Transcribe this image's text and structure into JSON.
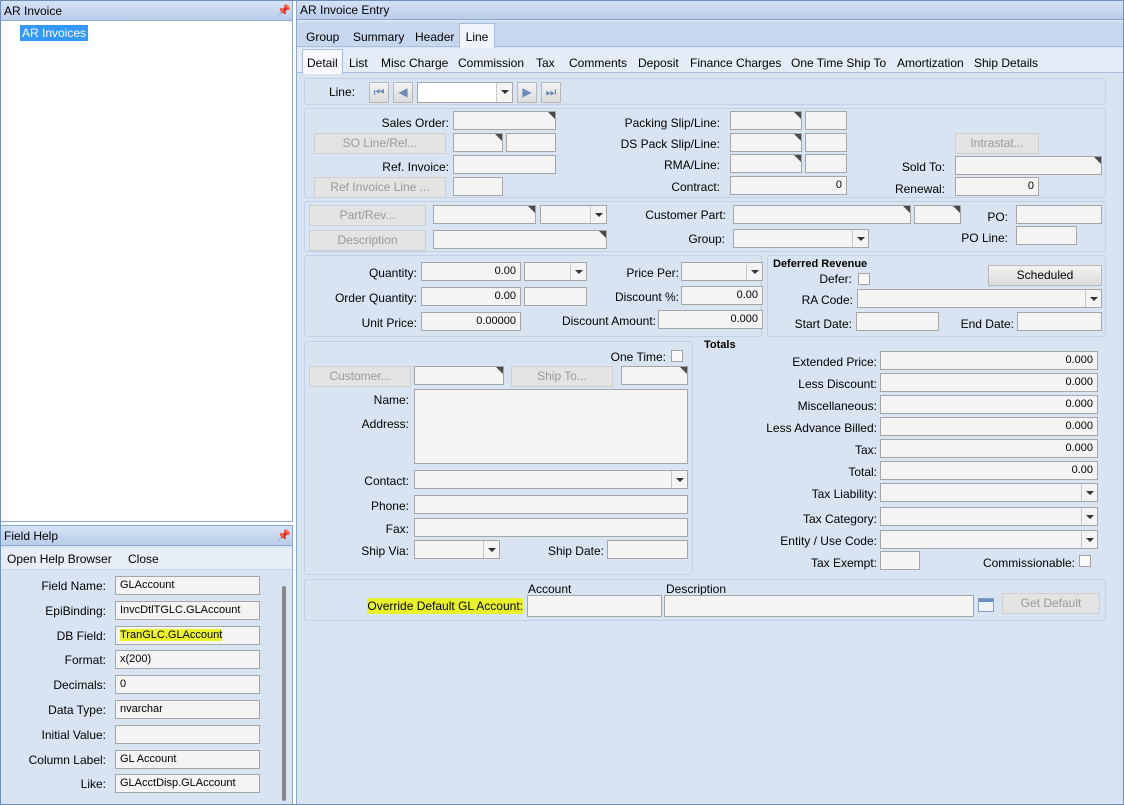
{
  "left_panel": {
    "title": "AR Invoice",
    "tree_item": "AR Invoices"
  },
  "field_help": {
    "title": "Field Help",
    "open_help_browser": "Open Help Browser",
    "close": "Close",
    "rows": [
      {
        "label": "Field Name:",
        "value": "GLAccount"
      },
      {
        "label": "EpiBinding:",
        "value": "InvcDtlTGLC.GLAccount"
      },
      {
        "label": "DB Field:",
        "value": "TranGLC.GLAccount"
      },
      {
        "label": "Format:",
        "value": "x(200)"
      },
      {
        "label": "Decimals:",
        "value": "0"
      },
      {
        "label": "Data Type:",
        "value": "nvarchar"
      },
      {
        "label": "Initial Value:",
        "value": ""
      },
      {
        "label": "Column Label:",
        "value": "GL Account"
      },
      {
        "label": "Like:",
        "value": "GLAcctDisp.GLAccount"
      }
    ]
  },
  "main": {
    "title": "AR Invoice Entry",
    "top_tabs": [
      "Group",
      "Summary",
      "Header",
      "Line"
    ],
    "active_top_tab": "Line",
    "sub_tabs": [
      "Detail",
      "List",
      "Misc Charge",
      "Commission",
      "Tax",
      "Comments",
      "Deposit",
      "Finance Charges",
      "One Time Ship To",
      "Amortization",
      "Ship Details"
    ],
    "active_sub_tab": "Detail",
    "line_label": "Line:",
    "order_section": {
      "sales_order": "Sales Order:",
      "so_line_rel": "SO Line/Rel...",
      "ref_invoice": "Ref. Invoice:",
      "ref_invoice_line": "Ref Invoice Line ...",
      "packing_slip_line": "Packing Slip/Line:",
      "ds_pack_slip_line": "DS Pack Slip/Line:",
      "rma_line": "RMA/Line:",
      "contract": "Contract:",
      "contract_value": "0",
      "intrastat": "Intrastat...",
      "sold_to": "Sold To:",
      "renewal": "Renewal:",
      "renewal_value": "0"
    },
    "part_section": {
      "part_rev": "Part/Rev...",
      "description": "Description",
      "customer_part": "Customer Part:",
      "group": "Group:",
      "po": "PO:",
      "po_line": "PO Line:"
    },
    "qty_section": {
      "quantity": "Quantity:",
      "quantity_value": "0.00",
      "order_quantity": "Order Quantity:",
      "order_quantity_value": "0.00",
      "unit_price": "Unit Price:",
      "unit_price_value": "0.00000",
      "price_per": "Price Per:",
      "discount_pct": "Discount %:",
      "discount_pct_value": "0.00",
      "discount_amount": "Discount Amount:",
      "discount_amount_value": "0.000"
    },
    "deferred": {
      "title": "Deferred Revenue",
      "defer": "Defer:",
      "scheduled": "Scheduled",
      "ra_code": "RA Code:",
      "start_date": "Start Date:",
      "end_date": "End Date:"
    },
    "ship_section": {
      "one_time": "One Time:",
      "customer": "Customer...",
      "ship_to": "Ship To...",
      "name": "Name:",
      "address": "Address:",
      "contact": "Contact:",
      "phone": "Phone:",
      "fax": "Fax:",
      "ship_via": "Ship Via:",
      "ship_date": "Ship Date:"
    },
    "totals": {
      "title": "Totals",
      "extended_price": "Extended Price:",
      "extended_price_value": "0.000",
      "less_discount": "Less Discount:",
      "less_discount_value": "0.000",
      "miscellaneous": "Miscellaneous:",
      "miscellaneous_value": "0.000",
      "less_advance_billed": "Less Advance Billed:",
      "less_advance_billed_value": "0.000",
      "tax": "Tax:",
      "tax_value": "0.000",
      "total": "Total:",
      "total_value": "0.00",
      "tax_liability": "Tax Liability:",
      "tax_category": "Tax Category:",
      "entity_use_code": "Entity / Use Code:",
      "tax_exempt": "Tax Exempt:",
      "commissionable": "Commissionable:"
    },
    "gl": {
      "account_header": "Account",
      "description_header": "Description",
      "override_label": "Override Default GL Account:",
      "get_default": "Get Default"
    }
  },
  "colors": {
    "highlight": "#eaf32a",
    "panel_bg": "#d9e4f2",
    "title_bar": "#c8d8ee",
    "selection": "#3399ff"
  }
}
